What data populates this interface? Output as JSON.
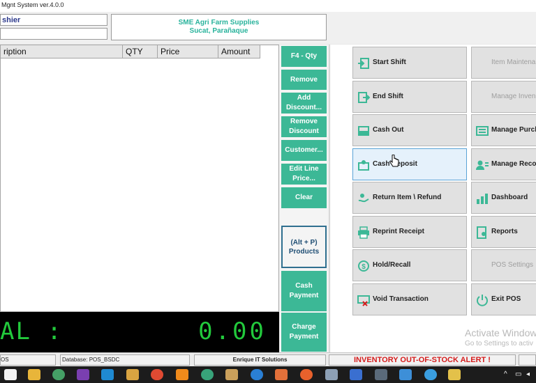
{
  "window": {
    "title": "Mgnt System ver.4.0.0"
  },
  "header": {
    "cashier_label": "shier",
    "store_name": "SME Agri Farm Supplies",
    "store_location": "Sucat, Parañaque"
  },
  "grid": {
    "columns": [
      "ription",
      "QTY",
      "Price",
      "Amount"
    ]
  },
  "total": {
    "label": "AL :",
    "value": "0.00"
  },
  "middle_buttons": {
    "qty": "F4 - Qty",
    "remove": "Remove",
    "add_discount_1": "Add",
    "add_discount_2": "Discount...",
    "remove_discount_1": "Remove",
    "remove_discount_2": "Discount",
    "customer": "Customer...",
    "edit_line_1": "Edit Line",
    "edit_line_2": "Price...",
    "clear": "Clear",
    "products_1": "(Alt + P)",
    "products_2": "Products",
    "cash_1": "Cash",
    "cash_2": "Payment",
    "charge_1": "Charge",
    "charge_2": "Payment"
  },
  "functions": {
    "start_shift": "Start Shift",
    "end_shift": "End Shift",
    "cash_out": "Cash Out",
    "cash_deposit": "Cash Deposit",
    "return_refund": "Return Item \\ Refund",
    "reprint_receipt": "Reprint Receipt",
    "hold_recall": "Hold/Recall",
    "void_transaction": "Void Transaction",
    "item_maintenance": "Item Maintena",
    "manage_inventory": "Manage Inven",
    "manage_purchases": "Manage Purch",
    "manage_records": "Manage Recor",
    "dashboard": "Dashboard",
    "reports": "Reports",
    "pos_settings": "POS Settings",
    "exit_pos": "Exit POS"
  },
  "watermark": {
    "line1": "Activate Window",
    "line2": "Go to Settings to activ"
  },
  "status": {
    "terminal": "OS",
    "database": "Database: POS_BSDC",
    "company": "Enrique IT Solutions",
    "alert": "INVENTORY OUT-OF-STOCK ALERT !"
  },
  "colors": {
    "accent_green": "#3cb896",
    "store_text": "#29b39c",
    "total_digits": "#22c93c",
    "alert_red": "#d41c1c"
  }
}
